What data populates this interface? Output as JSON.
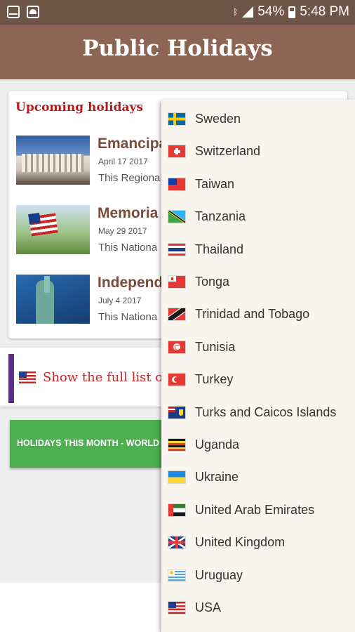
{
  "status_bar": {
    "battery": "54%",
    "time": "5:48 PM",
    "icons": [
      "mail-notification-icon",
      "cloud-notification-icon",
      "bluetooth-icon",
      "signal-icon",
      "battery-icon"
    ]
  },
  "app_bar": {
    "title": "Public Holidays",
    "color": "#8d6555"
  },
  "upcoming": {
    "title": "Upcoming holidays",
    "items": [
      {
        "name": "Emancipa",
        "date": "April 17 2017",
        "desc": "This Regiona",
        "image": "lincoln-memorial-photo"
      },
      {
        "name": "Memoria",
        "date": "May 29 2017",
        "desc": "This Nationa",
        "image": "american-flag-photo"
      },
      {
        "name": "Independ",
        "date": "July 4 2017",
        "desc": "This Nationa",
        "image": "statue-of-liberty-photo"
      }
    ]
  },
  "full_list": {
    "label": "Show the full list of"
  },
  "month_button": {
    "label": "HOLIDAYS THIS MONTH - WORLD",
    "color": "#4caf50"
  },
  "dropdown": {
    "items": [
      {
        "label": "Sweden",
        "flag": "sweden"
      },
      {
        "label": "Switzerland",
        "flag": "switzerland"
      },
      {
        "label": "Taiwan",
        "flag": "taiwan"
      },
      {
        "label": "Tanzania",
        "flag": "tanzania"
      },
      {
        "label": "Thailand",
        "flag": "thailand"
      },
      {
        "label": "Tonga",
        "flag": "tonga"
      },
      {
        "label": "Trinidad and Tobago",
        "flag": "trinidad"
      },
      {
        "label": "Tunisia",
        "flag": "tunisia"
      },
      {
        "label": "Turkey",
        "flag": "turkey"
      },
      {
        "label": "Turks and Caicos Islands",
        "flag": "turks"
      },
      {
        "label": "Uganda",
        "flag": "uganda"
      },
      {
        "label": "Ukraine",
        "flag": "ukraine"
      },
      {
        "label": "United Arab Emirates",
        "flag": "uae"
      },
      {
        "label": "United Kingdom",
        "flag": "uk"
      },
      {
        "label": "Uruguay",
        "flag": "uruguay"
      },
      {
        "label": "USA",
        "flag": "usa"
      }
    ]
  }
}
